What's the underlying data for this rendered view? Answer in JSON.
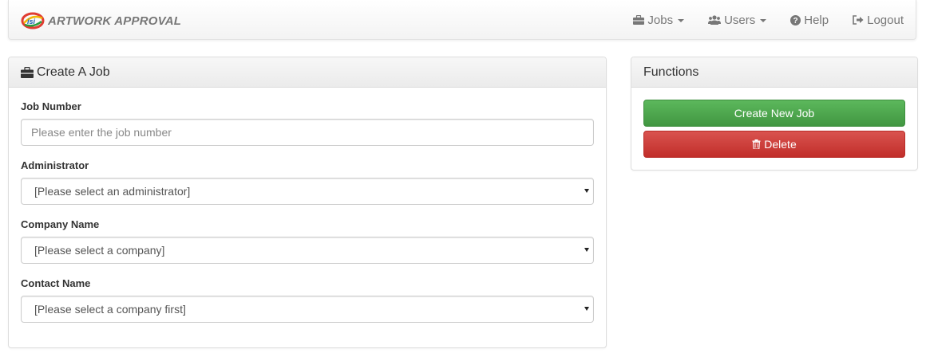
{
  "brand": {
    "name": "ARTWORK APPROVAL",
    "logo_icon": "isi-logo-icon"
  },
  "nav": {
    "jobs": "Jobs",
    "users": "Users",
    "help": "Help",
    "logout": "Logout"
  },
  "create_panel": {
    "title": "Create A Job",
    "fields": {
      "job_number": {
        "label": "Job Number",
        "placeholder": "Please enter the job number",
        "value": ""
      },
      "administrator": {
        "label": "Administrator",
        "selected": "[Please select an administrator]"
      },
      "company_name": {
        "label": "Company Name",
        "selected": "[Please select a company]"
      },
      "contact_name": {
        "label": "Contact Name",
        "selected": "[Please select a company first]"
      }
    }
  },
  "functions_panel": {
    "title": "Functions",
    "create_label": "Create New Job",
    "delete_label": "Delete"
  },
  "colors": {
    "success": "#5cb85c",
    "danger": "#d9534f",
    "nav_text": "#777777"
  }
}
